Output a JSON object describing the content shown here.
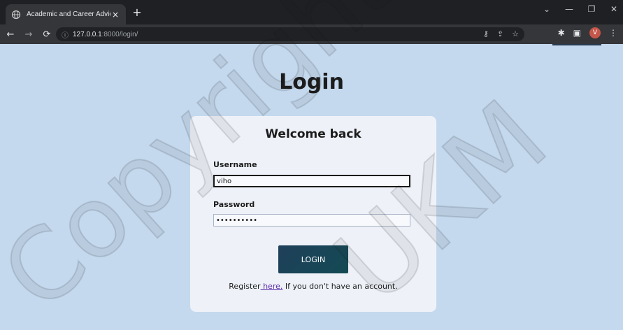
{
  "browser": {
    "tab_title": "Academic and Career Advice",
    "tab_close": "×",
    "new_tab": "+",
    "url_host": "127.0.0.1",
    "url_path": ":8000/login/",
    "avatar_letter": "V",
    "icons": [
      "globe-icon",
      "back-icon",
      "forward-icon",
      "reload-icon",
      "info-icon",
      "key-icon",
      "share-icon",
      "star-icon",
      "puzzle-icon",
      "sidepanel-icon",
      "menu-icon"
    ]
  },
  "page": {
    "heading": "Login",
    "card_title": "Welcome back",
    "username_label": "Username",
    "username_value": "viho",
    "password_label": "Password",
    "password_value": "••••••••••",
    "login_button": "LOGIN",
    "register_prefix": "Register",
    "register_link": " here.",
    "register_suffix": " If you don't have an account."
  },
  "watermark": {
    "text_1": "Copyright@",
    "text_2": "UKM",
    "color": "#1a1a1a"
  },
  "colors": {
    "page_bg": "#c4d9ee",
    "card_bg": "#eef2f8",
    "button": "#1f3f5a",
    "link": "#5a2aa8"
  }
}
